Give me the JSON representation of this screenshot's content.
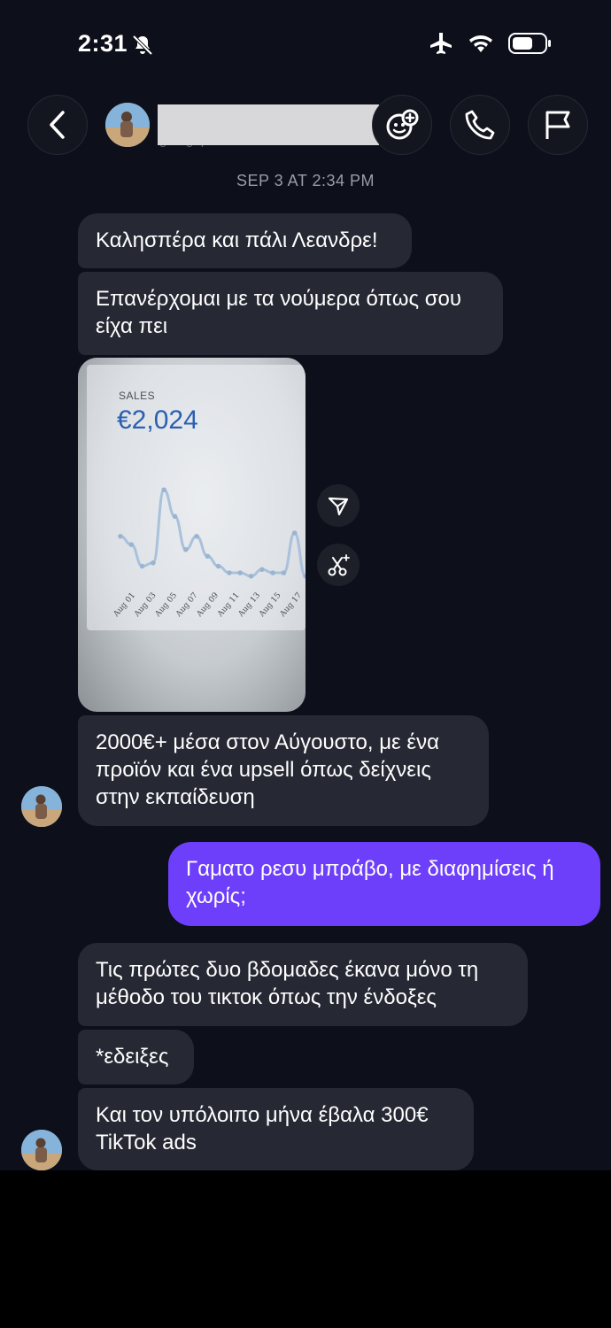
{
  "status_bar": {
    "time": "2:31"
  },
  "header": {
    "blurred_username": "georgeparaskeva"
  },
  "timestamp": "SEP 3 AT 2:34 PM",
  "messages": {
    "m1": "Καλησπέρα και πάλι Λεανδρε!",
    "m2": "Επανέρχομαι με τα νούμερα όπως σου είχα πει",
    "m3": "2000€+ μέσα στον Αύγουστο, με ένα προϊόν και ένα upsell όπως δείχνεις στην εκπαίδευση",
    "m4": "Γαματο ρεσυ μπράβο, με διαφημίσεις ή χωρίς;",
    "m5": "Τις πρώτες δυο βδομαδες έκανα μόνο τη μέθοδο του τικτοκ όπως την ένδοξες",
    "m6": "*εδειξες",
    "m7": "Και τον υπόλοιπο μήνα έβαλα 300€ TikTok ads"
  },
  "photo": {
    "sales_label": "SALES",
    "sales_value": "€2,024"
  },
  "chart_data": {
    "type": "line",
    "title": "SALES",
    "categories": [
      "Aug 01",
      "Aug 03",
      "Aug 05",
      "Aug 07",
      "Aug 09",
      "Aug 11",
      "Aug 13",
      "Aug 15",
      "Aug 17"
    ],
    "x": [
      "Aug 01",
      "Aug 02",
      "Aug 03",
      "Aug 04",
      "Aug 05",
      "Aug 06",
      "Aug 07",
      "Aug 08",
      "Aug 09",
      "Aug 10",
      "Aug 11",
      "Aug 12",
      "Aug 13",
      "Aug 14",
      "Aug 15",
      "Aug 16",
      "Aug 17",
      "Aug 18"
    ],
    "values": [
      150,
      125,
      60,
      70,
      290,
      210,
      110,
      150,
      90,
      60,
      40,
      40,
      30,
      50,
      40,
      40,
      160,
      30
    ],
    "ylim": [
      0,
      320
    ],
    "grid": false
  },
  "colors": {
    "background": "#0d0f1a",
    "incoming_bubble": "#262833",
    "outgoing_bubble": "#6e3ffb",
    "chart_line": "#a9c1dc"
  }
}
